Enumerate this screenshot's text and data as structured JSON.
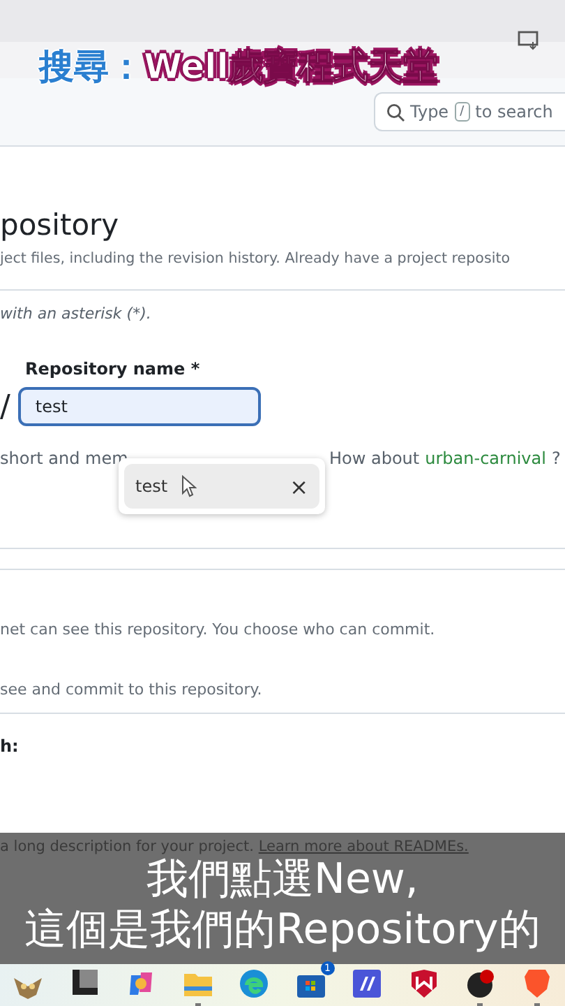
{
  "overlay_title": {
    "prefix": "搜尋：",
    "channel": "Well歲寶程式天堂"
  },
  "header": {
    "search": {
      "placeholder_before": "Type",
      "key": "/",
      "placeholder_after": "to search"
    }
  },
  "page": {
    "heading": "pository",
    "subtitle": "ject files, including the revision history. Already have a project reposito",
    "required_note": "with an asterisk (*).",
    "repo_name": {
      "label": "Repository name *",
      "separator": "/",
      "value": "test",
      "focused": true
    },
    "hint": {
      "before": "short and mem",
      "suggestion_prefix": "How about",
      "suggestion": "urban-carnival",
      "after": "?"
    },
    "autocomplete": [
      {
        "text": "test",
        "remove": "×"
      }
    ],
    "public_desc": "net can see this repository. You choose who can commit.",
    "private_desc": "see and commit to this repository.",
    "section_label": "h:",
    "readme_desc": {
      "text": "a long description for your project.",
      "link": "Learn more about READMEs."
    }
  },
  "subtitles": [
    "我們點選New,",
    "這個是我們的Repository的"
  ],
  "taskbar": [
    {
      "kind": "owl"
    },
    {
      "kind": "square"
    },
    {
      "kind": "copilot"
    },
    {
      "kind": "folder",
      "running": true
    },
    {
      "kind": "edge"
    },
    {
      "kind": "store",
      "badge": "1"
    },
    {
      "kind": "app"
    },
    {
      "kind": "shield"
    },
    {
      "kind": "obs",
      "running": true
    },
    {
      "kind": "brave",
      "running": true
    }
  ]
}
